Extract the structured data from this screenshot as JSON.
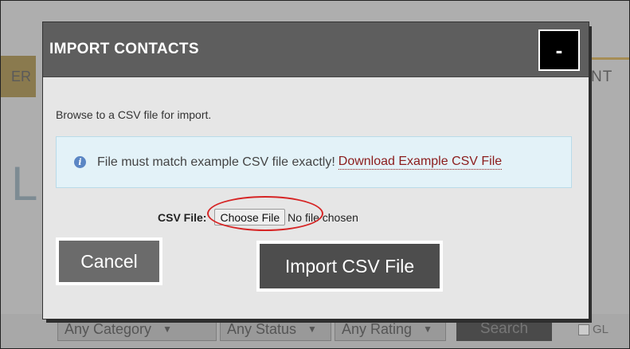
{
  "background": {
    "left_tab_text": "ER",
    "right_text": "NT",
    "big_letter": "L",
    "filters": {
      "category": "Any Category",
      "status": "Any Status",
      "rating": "Any Rating",
      "search_label": "Search",
      "checkbox_label": "GL"
    }
  },
  "modal": {
    "title": "IMPORT CONTACTS",
    "close_label": "-",
    "instructions": "Browse to a CSV file for import.",
    "alert": {
      "text": "File must match example CSV file exactly!",
      "link_text": "Download Example CSV File",
      "icon": "info-icon"
    },
    "file_field": {
      "label": "CSV File:",
      "button_label": "Choose File",
      "status": "No file chosen"
    },
    "buttons": {
      "cancel": "Cancel",
      "import": "Import CSV File"
    }
  },
  "colors": {
    "header_bg": "#5e5e5e",
    "alert_bg": "#e3f2f8",
    "link": "#8b1c1c",
    "annotation": "#d62525"
  }
}
